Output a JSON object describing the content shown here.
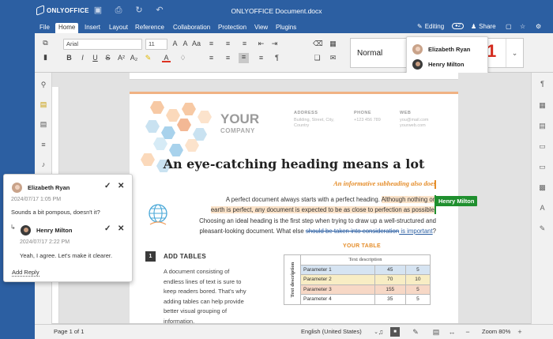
{
  "app": {
    "doc_title": "ONLYOFFICE Document.docx",
    "logo_text": "ONLYOFFICE"
  },
  "menu": {
    "items": [
      "File",
      "Home",
      "Insert",
      "Layout",
      "Reference",
      "Collaboration",
      "Protection",
      "View",
      "Plugins"
    ],
    "active": "Home",
    "editing_label": "Editing",
    "share_label": "Share"
  },
  "toolbar": {
    "font_name": "Arial",
    "font_size": "11",
    "style_name": "Normal",
    "style_num": "1"
  },
  "collaborators": [
    {
      "name": "Elizabeth Ryan"
    },
    {
      "name": "Henry Milton"
    }
  ],
  "document": {
    "logo_your": "YOUR",
    "logo_company": "COMPANY",
    "address_label": "ADDRESS",
    "address_value_1": "Building, Street, City,",
    "address_value_2": "Country",
    "phone_label": "PHONE",
    "phone_value": "+123 456 789",
    "web_label": "WEB",
    "web_value_1": "you@mail.com",
    "web_value_2": "yourweb.com",
    "heading_part1": "An eye-",
    "heading_part2": "catching",
    "heading_part3": " heading means a lot",
    "subheading": "An informative subheading also does",
    "para_line1_a": "A perfect document always starts with a perfect heading. ",
    "para_line1_b": "Although nothing on",
    "para_line2": "earth is perfect, any document is expected to be as close to perfection as possible.",
    "para_line3": "Choosing an ideal heading is the first step when trying to draw up a well-structured and",
    "para_line4_a": "pleasant-looking document. What else ",
    "para_line4_b": "should be taken into consideration",
    "para_line4_c": " is important",
    "para_line4_d": "?",
    "section_num": "1",
    "section_title": "ADD TABLES",
    "section_text": "A document consisting of endless lines of text is sure to keep readers bored. That's why adding tables can help provide better visual grouping of information.",
    "your_table_title": "YOUR TABLE",
    "table_header": "Text description",
    "table_side_label": "Text description",
    "table_rows": [
      {
        "param": "Parameter 1",
        "v1": "45",
        "v2": "5"
      },
      {
        "param": "Parameter 2",
        "v1": "70",
        "v2": "10"
      },
      {
        "param": "Parameter 3",
        "v1": "155",
        "v2": "5"
      },
      {
        "param": "Parameter 4",
        "v1": "35",
        "v2": "5"
      }
    ]
  },
  "cursor_tag": "Henry Milton",
  "comment": {
    "author": "Elizabeth Ryan",
    "date": "2024/07/17 1:05 PM",
    "text": "Sounds a bit pompous, doesn't it?",
    "reply_author": "Henry Milton",
    "reply_date": "2024/07/17 2:22 PM",
    "reply_text": "Yeah, I agree. Let's make it clearer.",
    "add_reply_label": "Add Reply"
  },
  "status": {
    "page": "Page 1 of 1",
    "language": "English (United States)",
    "zoom": "Zoom 80%"
  },
  "colors": {
    "brand": "#2c5fa2",
    "accent_orange": "#e58d2a",
    "cursor_green": "#1f8f2e"
  }
}
